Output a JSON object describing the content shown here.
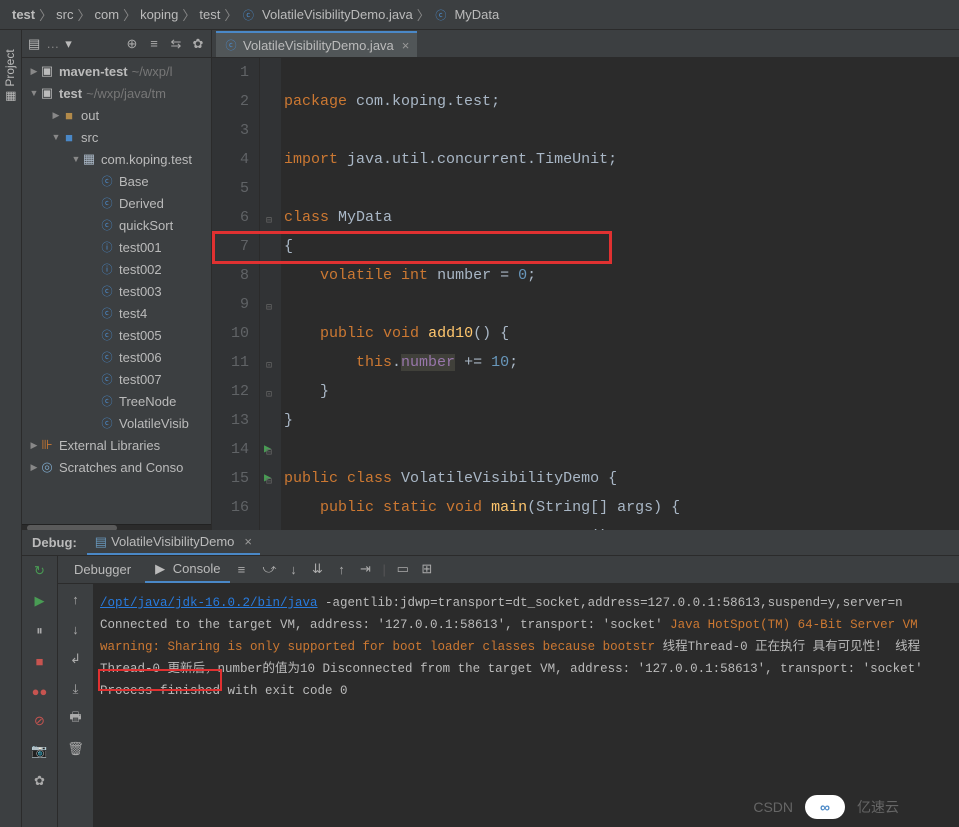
{
  "breadcrumb": [
    "test",
    "src",
    "com",
    "koping",
    "test",
    "VolatileVisibilityDemo.java",
    "MyData"
  ],
  "breadcrumb_icons": [
    "",
    "",
    "",
    "",
    "",
    "class-icon",
    "class-icon"
  ],
  "project_side_label": "Project",
  "project_panel": {
    "title": "…"
  },
  "tree": {
    "root1": {
      "name": "maven-test",
      "hint": "~/wxp/l"
    },
    "root2": {
      "name": "test",
      "hint": "~/wxp/java/tm"
    },
    "out": "out",
    "src": "src",
    "pkg": "com.koping.test",
    "files": [
      "Base",
      "Derived",
      "quickSort",
      "test001",
      "test002",
      "test003",
      "test4",
      "test005",
      "test006",
      "test007",
      "TreeNode",
      "VolatileVisib"
    ],
    "ext_lib": "External Libraries",
    "scratches": "Scratches and Conso"
  },
  "editor": {
    "tab_name": "VolatileVisibilityDemo.java",
    "lines": {
      "1": "package com.koping.test;",
      "2": "",
      "3": "import java.util.concurrent.TimeUnit;",
      "4": "",
      "5": "class MyData",
      "6": "{",
      "7": "    volatile int number = 0;",
      "8": "",
      "9": "    public void add10() {",
      "10": "        this.number += 10;",
      "11": "    }",
      "12": "}",
      "13": "",
      "14": "public class VolatileVisibilityDemo {",
      "15": "    public static void main(String[] args) {",
      "16": "        MyData myData = new MyData();"
    }
  },
  "debug": {
    "label": "Debug:",
    "tab": "VolatileVisibilityDemo",
    "sub_debugger": "Debugger",
    "sub_console": "Console"
  },
  "console": {
    "line1_link": "/opt/java/jdk-16.0.2/bin/java",
    "line1_rest": " -agentlib:jdwp=transport=dt_socket,address=127.0.0.1:58613,suspend=y,server=n",
    "line2": "Connected to the target VM, address: '127.0.0.1:58613', transport: 'socket'",
    "line3": "Java HotSpot(TM) 64-Bit Server VM warning: Sharing is only supported for boot loader classes because bootstr",
    "line4": "线程Thread-0   正在执行",
    "line5": "具有可见性！",
    "line6": "线程Thread-0   更新后，number的值为10",
    "line7": "Disconnected from the target VM, address: '127.0.0.1:58613', transport: 'socket'",
    "line8": "",
    "line9": "Process finished with exit code 0"
  },
  "watermark": {
    "csdn": "CSDN",
    "yisu": "亿速云"
  }
}
